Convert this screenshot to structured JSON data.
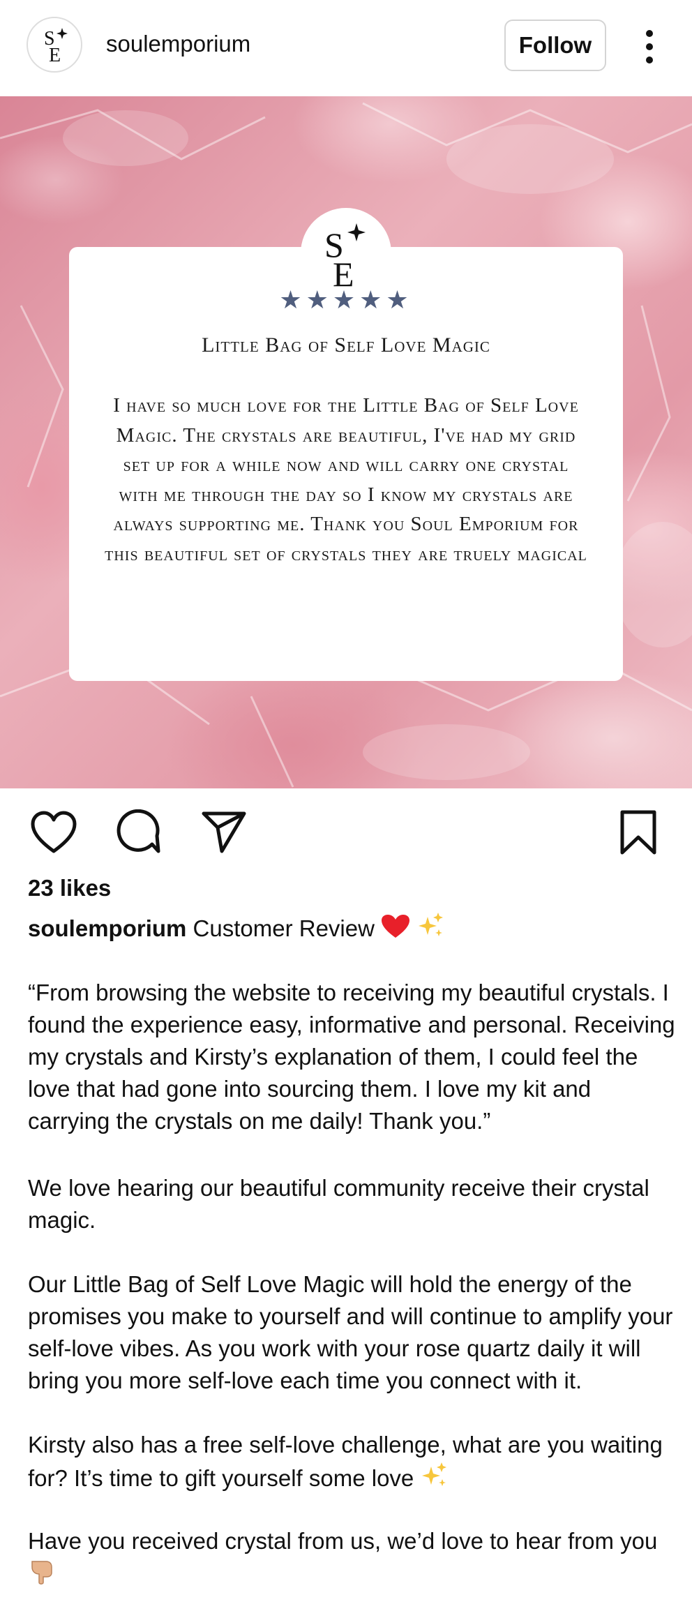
{
  "header": {
    "username": "soulemporium",
    "follow_label": "Follow",
    "more_icon": "more-vertical-icon",
    "avatar_icon": "soul-emporium-logo-icon"
  },
  "post": {
    "background": "rose-quartz-crystals",
    "card": {
      "logo_icon": "soul-emporium-logo-icon",
      "stars": "★★★★★",
      "star_color": "#505e7e",
      "title": "Little Bag of Self Love Magic",
      "body": "I have so much love for the Little Bag of Self Love Magic. The crystals are beautiful, I've had my grid set up for a while now and will carry one crystal with me through the day so I know my crystals are always supporting me. Thank you Soul Emporium for this beautiful set of crystals they are truely magical"
    }
  },
  "actions": {
    "like_icon": "heart-icon",
    "comment_icon": "comment-icon",
    "share_icon": "send-icon",
    "save_icon": "bookmark-icon"
  },
  "likes": "23 likes",
  "caption": {
    "username": "soulemporium",
    "text": "Customer Review",
    "emojis": [
      "red-heart-emoji",
      "sparkles-emoji"
    ],
    "paragraphs": [
      "“From browsing the website to receiving my beautiful crystals. I found the experience easy, informative and personal. Receiving my crystals and Kirsty’s explanation of them, I could feel the love that had gone into sourcing them. I love my kit and carrying the crystals on me daily! Thank you.”",
      "We love hearing our beautiful community receive their crystal magic.",
      "Our Little Bag of Self Love Magic will hold the energy of the promises you make to yourself and will continue to amplify your self-love vibes. As you work with your rose quartz daily it will bring you more self-love each time you connect with it.",
      "Kirsty also has a free self-love challenge, what are you waiting for? It’s time to gift yourself some love",
      "Have you received crystal from us, we’d love to hear from you"
    ]
  }
}
